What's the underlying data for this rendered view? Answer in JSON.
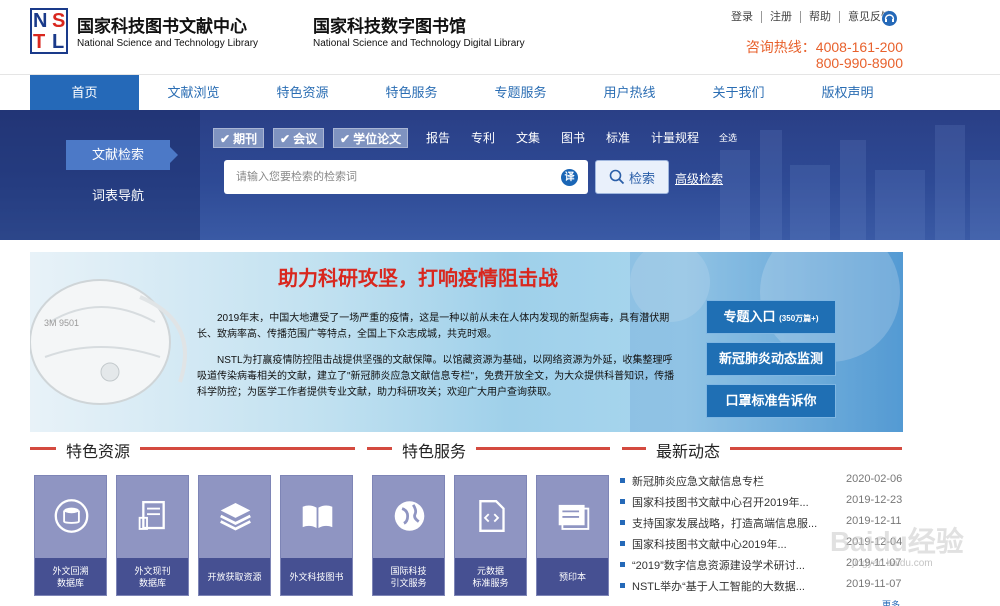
{
  "header": {
    "logo_letters": [
      "N",
      "S",
      "T",
      "L"
    ],
    "title1_cn": "国家科技图书文献中心",
    "title1_en": "National Science and Technology Library",
    "title2_cn": "国家科技数字图书馆",
    "title2_en": "National Science and Technology Digital Library",
    "links": [
      "登录",
      "注册",
      "帮助",
      "意见反馈"
    ],
    "hotline_label": "咨询热线：4008-161-200",
    "hotline2": "800-990-8900"
  },
  "nav": {
    "items": [
      "首页",
      "文献浏览",
      "特色资源",
      "特色服务",
      "专题服务",
      "用户热线",
      "关于我们",
      "版权声明"
    ],
    "active_index": 0
  },
  "search": {
    "left_tabs": [
      "文献检索",
      "词表导航"
    ],
    "categories_selected": [
      "期刊",
      "会议",
      "学位论文"
    ],
    "categories": [
      "报告",
      "专利",
      "文集",
      "图书",
      "标准",
      "计量规程",
      "全选"
    ],
    "placeholder": "请输入您要检索的检索词",
    "translate": "译",
    "button": "检索",
    "advanced": "高级检索"
  },
  "banner": {
    "title": "助力科研攻坚，打响疫情阻击战",
    "mask_text": "3M 9501",
    "para1": "2019年末，中国大地遭受了一场严重的疫情，这是一种以前从未在人体内发现的新型病毒，具有潜伏期长、致病率高、传播范围广等特点，全国上下众志成城，共克时艰。",
    "para2": "NSTL为打赢疫情防控阻击战提供坚强的文献保障。以馆藏资源为基础，以网络资源为外延，收集整理呼吸道传染病毒相关的文献，建立了\"新冠肺炎应急文献信息专栏\"，免费开放全文，为大众提供科普知识，传播科学防控；为医学工作者提供专业文献，助力科研攻关；欢迎广大用户查询获取。",
    "btn1": "专题入口",
    "btn1_note": "(350万篇+)",
    "btn2": "新冠肺炎动态监测",
    "btn3": "口罩标准告诉你"
  },
  "sections": {
    "res_title": "特色资源",
    "svc_title": "特色服务",
    "news_title": "最新动态"
  },
  "resources": [
    {
      "label": "外文回溯\n数据库",
      "icon": "database-icon"
    },
    {
      "label": "外文现刊\n数据库",
      "icon": "newspaper-icon"
    },
    {
      "label": "开放获取资源",
      "icon": "layers-icon"
    },
    {
      "label": "外文科技图书",
      "icon": "book-icon"
    }
  ],
  "services": [
    {
      "label": "国际科技\n引文服务",
      "icon": "globe-icon"
    },
    {
      "label": "元数据\n标准服务",
      "icon": "code-file-icon"
    },
    {
      "label": "预印本",
      "icon": "preprint-icon"
    }
  ],
  "news": [
    {
      "title": "新冠肺炎应急文献信息专栏",
      "date": "2020-02-06"
    },
    {
      "title": "国家科技图书文献中心召开2019年...",
      "date": "2019-12-23"
    },
    {
      "title": "支持国家发展战略，打造高端信息服...",
      "date": "2019-12-11"
    },
    {
      "title": "国家科技图书文献中心2019年...",
      "date": "2019-12-04"
    },
    {
      "title": "“2019”数字信息资源建设学术研讨...",
      "date": "2019-11-07"
    },
    {
      "title": "NSTL举办“基于人工智能的大数据...",
      "date": "2019-11-07"
    }
  ],
  "more": "更多",
  "watermark": "Baidu经验",
  "watermark_url": "jingyan.baidu.com",
  "colors": {
    "brand_blue": "#2569b8",
    "accent_red": "#d44a3f",
    "hotline_orange": "#e8612c"
  }
}
